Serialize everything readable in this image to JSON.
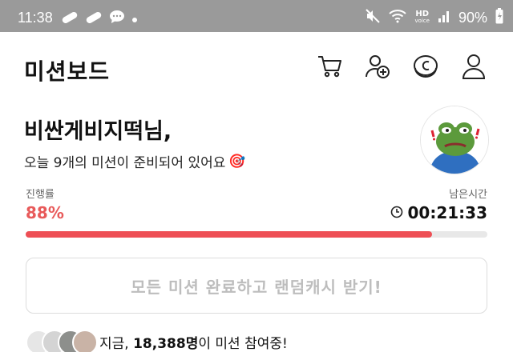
{
  "status_bar": {
    "time": "11:38",
    "battery": "90%",
    "hd_label": "HD",
    "hd_sub": "voice",
    "left_icons": [
      "pill-icon",
      "pill-icon",
      "chat-bubble-icon",
      "dot-icon"
    ],
    "right_icons": [
      "mute-icon",
      "wifi-icon",
      "hd-voice-icon",
      "signal-icon",
      "battery-icon"
    ]
  },
  "header": {
    "title": "미션보드",
    "icons": [
      "cart-icon",
      "add-friend-icon",
      "cash-coin-icon",
      "profile-icon"
    ]
  },
  "greeting": {
    "name": "비싼게비지떡님,",
    "subtitle": "오늘 9개의 미션이 준비되어 있어요",
    "emoji": "🎯"
  },
  "progress": {
    "label": "진행률",
    "value": "88%",
    "fraction": 0.88,
    "remaining_label": "남은시간",
    "remaining_time": "00:21:33"
  },
  "cta": {
    "label": "모든 미션 완료하고 랜덤캐시 받기!"
  },
  "participants": {
    "prefix": "지금, ",
    "count": "18,388명",
    "suffix": "이 미션 참여중!"
  },
  "colors": {
    "accent": "#ee4f55",
    "progress_text": "#e85a5a",
    "status_bar_bg": "#9a9a9a",
    "disabled_text": "#bdbdbd"
  }
}
